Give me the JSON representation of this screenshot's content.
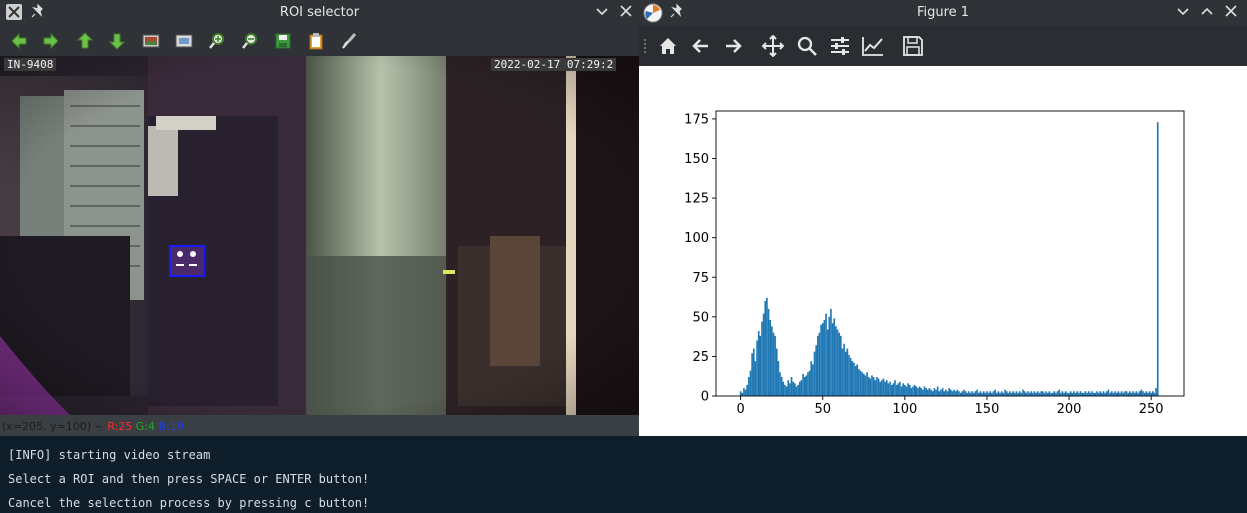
{
  "terminal": {
    "lines": [
      "[INFO] starting video stream",
      "Select a ROI and then press SPACE or ENTER button!",
      "Cancel the selection process by pressing c button!"
    ]
  },
  "roi_window": {
    "title": "ROI selector",
    "toolbar": [
      "arrow-left-icon",
      "arrow-right-icon",
      "arrow-up-icon",
      "arrow-down-icon",
      "image-icon",
      "frame-icon",
      "zoom-in-icon",
      "zoom-out-icon",
      "save-icon",
      "clipboard-icon",
      "brush-icon"
    ],
    "camera": {
      "id_label": "IN-9408",
      "timestamp": "2022-02-17 07:29:2"
    },
    "status": {
      "coords": "(x=205, y=100) ~",
      "r": "R:25",
      "g": "G:4",
      "b": "B:19",
      "r_color": "#ff2a2a",
      "g_color": "#22aa22",
      "b_color": "#1e3cff"
    }
  },
  "figure_window": {
    "title": "Figure 1",
    "toolbar": [
      "home-icon",
      "back-icon",
      "forward-icon",
      "pan-icon",
      "zoom-icon",
      "configure-subplots-icon",
      "edit-axis-icon",
      "save-figure-icon"
    ]
  },
  "chart_data": {
    "type": "bar",
    "title": "",
    "xlabel": "",
    "ylabel": "",
    "xlim": [
      -15,
      270
    ],
    "ylim": [
      0,
      180
    ],
    "xticks": [
      0,
      50,
      100,
      150,
      200,
      250
    ],
    "yticks": [
      0,
      25,
      50,
      75,
      100,
      125,
      150,
      175
    ],
    "bar_color": "#1f77b4",
    "x": [
      0,
      1,
      2,
      3,
      4,
      5,
      6,
      7,
      8,
      9,
      10,
      11,
      12,
      13,
      14,
      15,
      16,
      17,
      18,
      19,
      20,
      21,
      22,
      23,
      24,
      25,
      26,
      27,
      28,
      29,
      30,
      31,
      32,
      33,
      34,
      35,
      36,
      37,
      38,
      39,
      40,
      41,
      42,
      43,
      44,
      45,
      46,
      47,
      48,
      49,
      50,
      51,
      52,
      53,
      54,
      55,
      56,
      57,
      58,
      59,
      60,
      61,
      62,
      63,
      64,
      65,
      66,
      67,
      68,
      69,
      70,
      71,
      72,
      73,
      74,
      75,
      76,
      77,
      78,
      79,
      80,
      81,
      82,
      83,
      84,
      85,
      86,
      87,
      88,
      89,
      90,
      91,
      92,
      93,
      94,
      95,
      96,
      97,
      98,
      99,
      100,
      101,
      102,
      103,
      104,
      105,
      106,
      107,
      108,
      109,
      110,
      111,
      112,
      113,
      114,
      115,
      116,
      117,
      118,
      119,
      120,
      121,
      122,
      123,
      124,
      125,
      126,
      127,
      128,
      129,
      130,
      131,
      132,
      133,
      134,
      135,
      136,
      137,
      138,
      139,
      140,
      141,
      142,
      143,
      144,
      145,
      146,
      147,
      148,
      149,
      150,
      151,
      152,
      153,
      154,
      155,
      156,
      157,
      158,
      159,
      160,
      161,
      162,
      163,
      164,
      165,
      166,
      167,
      168,
      169,
      170,
      171,
      172,
      173,
      174,
      175,
      176,
      177,
      178,
      179,
      180,
      181,
      182,
      183,
      184,
      185,
      186,
      187,
      188,
      189,
      190,
      191,
      192,
      193,
      194,
      195,
      196,
      197,
      198,
      199,
      200,
      201,
      202,
      203,
      204,
      205,
      206,
      207,
      208,
      209,
      210,
      211,
      212,
      213,
      214,
      215,
      216,
      217,
      218,
      219,
      220,
      221,
      222,
      223,
      224,
      225,
      226,
      227,
      228,
      229,
      230,
      231,
      232,
      233,
      234,
      235,
      236,
      237,
      238,
      239,
      240,
      241,
      242,
      243,
      244,
      245,
      246,
      247,
      248,
      249,
      250,
      251,
      252,
      253,
      254,
      255
    ],
    "values": [
      3,
      2,
      5,
      4,
      7,
      12,
      16,
      27,
      30,
      22,
      35,
      41,
      38,
      47,
      52,
      60,
      62,
      55,
      48,
      44,
      40,
      38,
      30,
      22,
      15,
      12,
      9,
      7,
      6,
      10,
      8,
      12,
      9,
      8,
      6,
      7,
      9,
      10,
      14,
      12,
      13,
      15,
      16,
      22,
      20,
      28,
      32,
      38,
      40,
      45,
      46,
      48,
      52,
      42,
      50,
      55,
      46,
      49,
      44,
      42,
      40,
      38,
      30,
      33,
      28,
      30,
      26,
      24,
      22,
      21,
      19,
      20,
      17,
      16,
      15,
      14,
      13,
      15,
      12,
      11,
      13,
      12,
      10,
      12,
      11,
      9,
      10,
      11,
      9,
      10,
      8,
      9,
      7,
      8,
      10,
      7,
      8,
      9,
      6,
      8,
      7,
      6,
      8,
      7,
      5,
      6,
      7,
      6,
      5,
      6,
      5,
      4,
      6,
      5,
      4,
      5,
      4,
      3,
      5,
      4,
      6,
      3,
      4,
      5,
      3,
      4,
      3,
      5,
      4,
      3,
      4,
      3,
      4,
      3,
      2,
      3,
      4,
      3,
      2,
      3,
      2,
      3,
      2,
      3,
      4,
      2,
      3,
      2,
      3,
      2,
      3,
      2,
      3,
      2,
      3,
      4,
      2,
      3,
      2,
      3,
      2,
      4,
      3,
      2,
      3,
      2,
      3,
      2,
      3,
      2,
      3,
      2,
      4,
      3,
      2,
      3,
      2,
      3,
      2,
      3,
      2,
      3,
      2,
      3,
      3,
      2,
      3,
      2,
      3,
      2,
      2,
      3,
      2,
      3,
      4,
      2,
      3,
      2,
      3,
      2,
      2,
      3,
      2,
      3,
      2,
      3,
      2,
      3,
      2,
      2,
      3,
      2,
      3,
      2,
      3,
      2,
      2,
      3,
      2,
      3,
      2,
      3,
      2,
      3,
      4,
      2,
      3,
      2,
      3,
      2,
      3,
      2,
      3,
      2,
      3,
      3,
      2,
      3,
      2,
      3,
      2,
      3,
      2,
      3,
      4,
      3,
      2,
      3,
      2,
      3,
      2,
      3,
      2,
      5,
      173
    ]
  }
}
